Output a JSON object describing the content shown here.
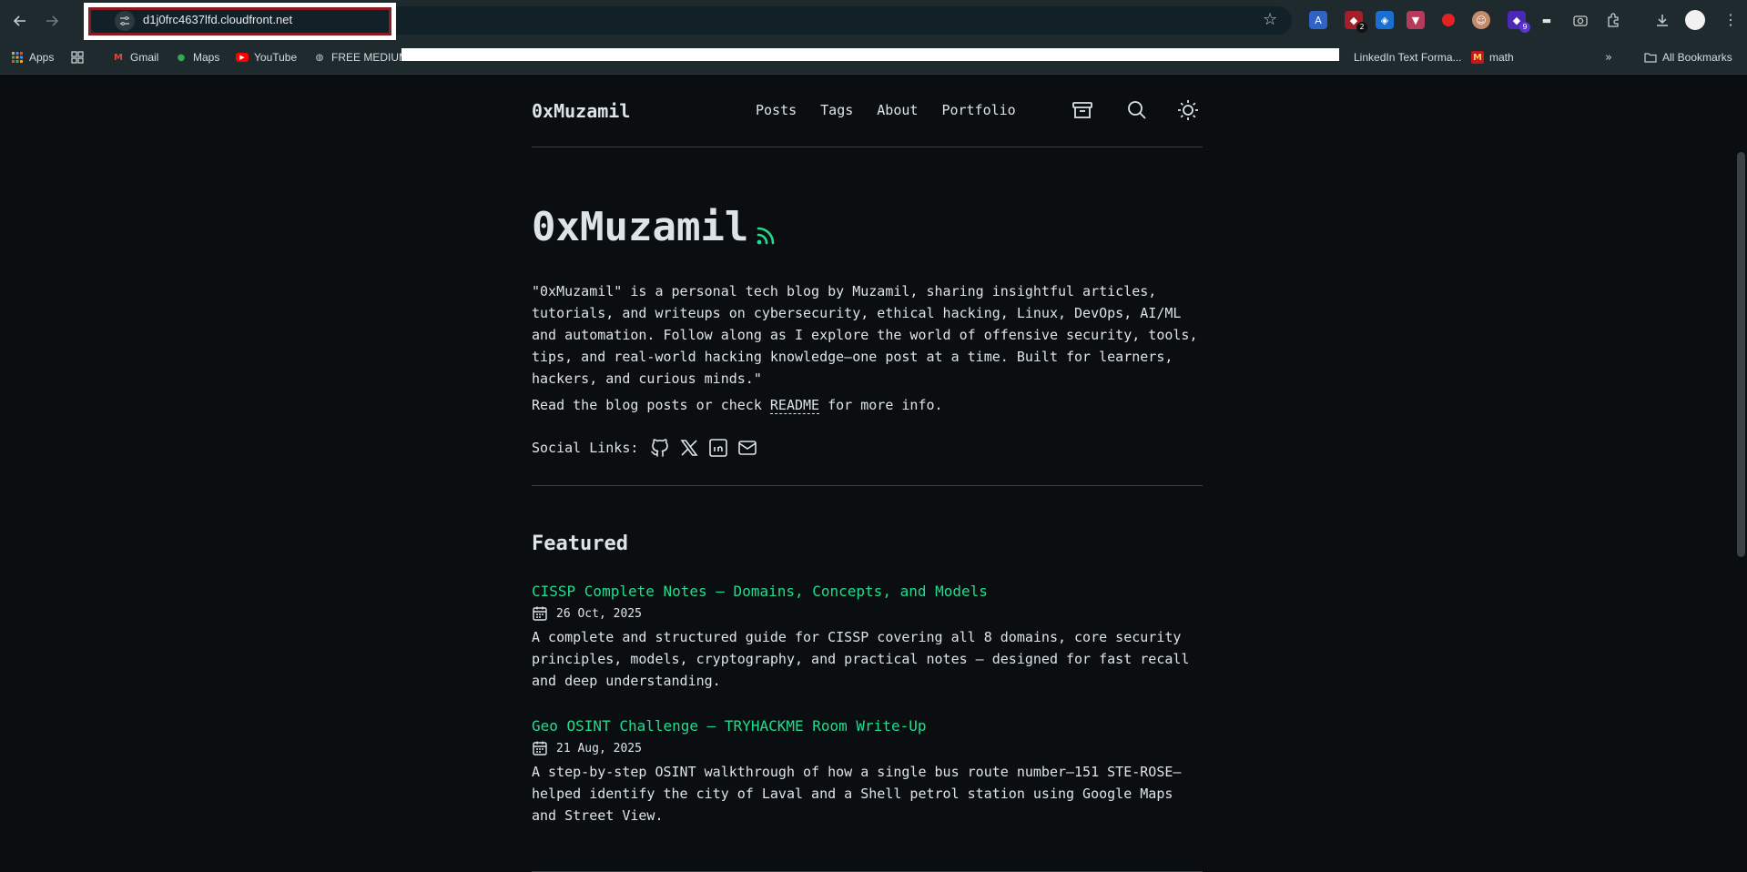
{
  "browser": {
    "url": "d1j0frc4637lfd.cloudfront.net",
    "extension_badges": {
      "ext2": "2",
      "ext9": "9"
    },
    "bookmarks": {
      "apps": "Apps",
      "gmail": "Gmail",
      "maps": "Maps",
      "youtube": "YouTube",
      "free_medium": "FREE MEDIUM",
      "linkedin": "LinkedIn Text Forma...",
      "math": "math",
      "all_bookmarks": "All Bookmarks"
    }
  },
  "site": {
    "logo": "0xMuzamil",
    "nav": [
      "Posts",
      "Tags",
      "About",
      "Portfolio"
    ],
    "hero_title": "0xMuzamil",
    "intro": "\"0xMuzamil\" is a personal tech blog by Muzamil, sharing insightful articles, tutorials, and writeups on cybersecurity, ethical hacking, Linux, DevOps, AI/ML and automation. Follow along as I explore the world of offensive security, tools, tips, and real-world hacking knowledge—one post at a time. Built for learners, hackers, and curious minds.\"",
    "readme_prefix": "Read the blog posts or check ",
    "readme_link": "README",
    "readme_suffix": " for more info.",
    "social_label": "Social Links:",
    "featured_heading": "Featured",
    "posts": [
      {
        "title": "CISSP Complete Notes – Domains, Concepts, and Models",
        "date": "26 Oct, 2025",
        "desc": "A complete and structured guide for CISSP covering all 8 domains, core security principles, models, cryptography, and practical notes — designed for fast recall and deep understanding."
      },
      {
        "title": "Geo OSINT Challenge – TRYHACKME Room Write-Up",
        "date": "21 Aug, 2025",
        "desc": "A step-by-step OSINT walkthrough of how a single bus route number—151 STE-ROSE—helped identify the city of Laval and a Shell petrol station using Google Maps and Street View."
      }
    ]
  },
  "colors": {
    "page_bg": "#0a0e11",
    "text": "#dde4e8",
    "accent_green": "#1fdd8e",
    "chrome_bg": "#1f2a2f",
    "focus_outline": "#8b1a22"
  }
}
